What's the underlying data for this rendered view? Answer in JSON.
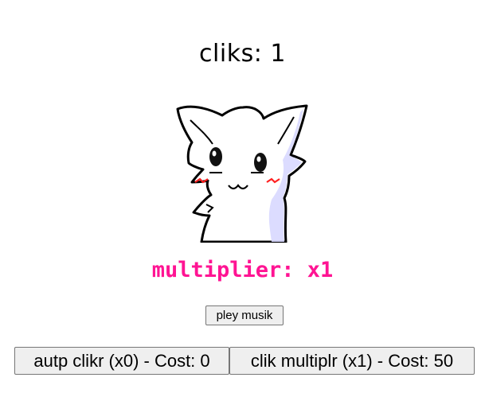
{
  "game": {
    "clicks_label": "cliks: 1",
    "clicks_count": 1
  },
  "cat": {
    "icon": "white-cat-face-icon",
    "outline_color": "#000000",
    "shade_color": "#d8d8ff",
    "blush_color": "#ff2020"
  },
  "multiplier": {
    "label": "multiplier: x1",
    "value": 1,
    "color": "#ff1493"
  },
  "music": {
    "button_label": "pley musik"
  },
  "shop": {
    "auto_clicker_label": "autp clikr (x0) - Cost: 0",
    "click_multiplier_label": "clik multiplr (x1) - Cost: 50"
  }
}
